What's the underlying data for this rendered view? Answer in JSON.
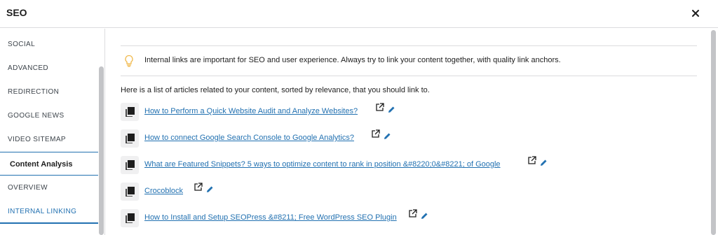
{
  "header": {
    "title": "SEO"
  },
  "sidebar": {
    "items": [
      {
        "label": "SOCIAL"
      },
      {
        "label": "ADVANCED"
      },
      {
        "label": "REDIRECTION"
      },
      {
        "label": "GOOGLE NEWS"
      },
      {
        "label": "VIDEO SITEMAP"
      },
      {
        "label": "Content Analysis"
      },
      {
        "label": "OVERVIEW"
      },
      {
        "label": "INTERNAL LINKING"
      }
    ]
  },
  "main": {
    "notice": "Internal links are important for SEO and user experience. Always try to link your content together, with quality link anchors.",
    "intro": "Here is a list of articles related to your content, sorted by relevance, that you should link to.",
    "links": [
      {
        "title": "How to Perform a Quick Website Audit and Analyze Websites?"
      },
      {
        "title": "How to connect Google Search Console to Google Analytics?"
      },
      {
        "title": "What are Featured Snippets? 5 ways to optimize content to rank in position &#8220;0&#8221; of Google"
      },
      {
        "title": "Crocoblock"
      },
      {
        "title": "How to Install and Setup SEOPress &#8211; Free WordPress SEO Plugin"
      }
    ]
  },
  "colors": {
    "link": "#2271b1",
    "accent": "#2271b1",
    "bulb": "#f0b849"
  },
  "icons": [
    "close-icon",
    "lightbulb-icon",
    "document-icon",
    "external-link-icon",
    "pencil-icon"
  ]
}
